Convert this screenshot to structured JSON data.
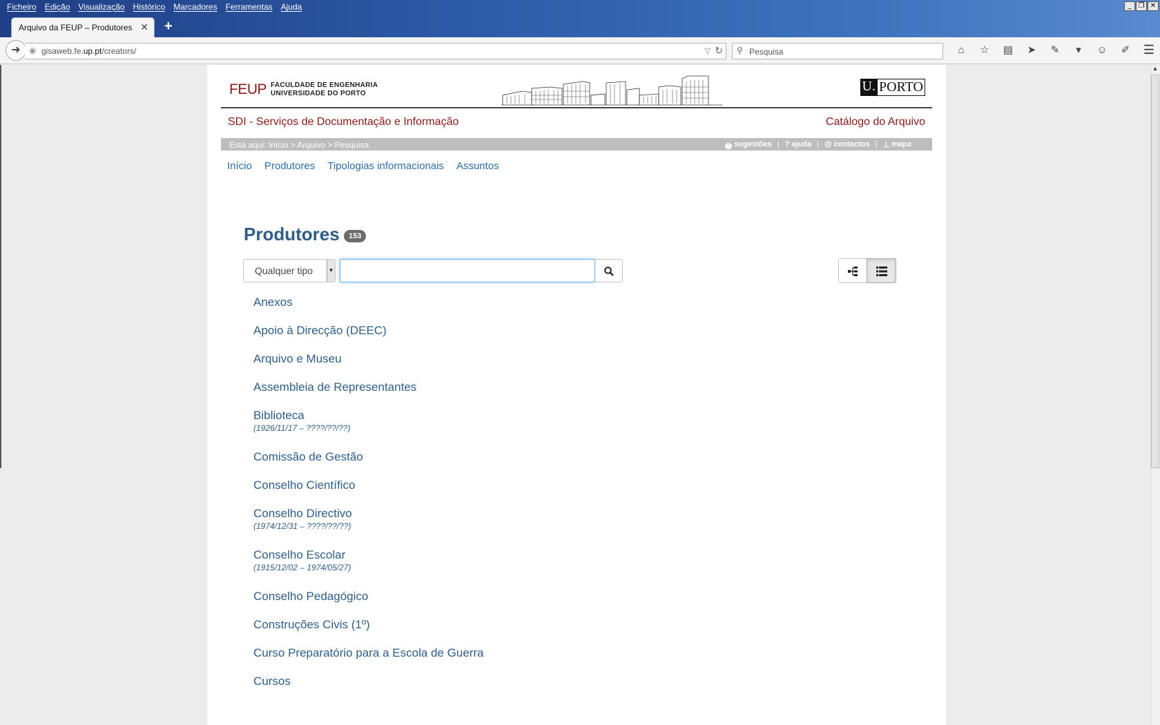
{
  "browser": {
    "menu": [
      "Ficheiro",
      "Edição",
      "Visualização",
      "Histórico",
      "Marcadores",
      "Ferramentas",
      "Ajuda"
    ],
    "tab_title": "Arquivo da FEUP – Produtores",
    "url_prefix": "gisaweb.fe.",
    "url_domain": "up.pt",
    "url_path": "/creators/",
    "search_placeholder": "Pesquisa"
  },
  "header": {
    "feup_mark": "FEUP",
    "feup_line1": "FACULDADE DE ENGENHARIA",
    "feup_line2": "UNIVERSIDADE DO PORTO",
    "uporto_u": "U.",
    "uporto_rest": "PORTO",
    "sdi": "SDI - Serviços de Documentação e Informação",
    "catalogo": "Catálogo do Arquivo"
  },
  "breadcrumb": {
    "text": "Está aqui: Início > Arquivo > Pesquisa",
    "links": [
      "sugestões",
      "ajuda",
      "contactos",
      "mapa"
    ]
  },
  "nav": [
    "Início",
    "Produtores",
    "Tipologias informacionais",
    "Assuntos"
  ],
  "main": {
    "title": "Produtores",
    "count": "153",
    "type_select": "Qualquer tipo",
    "query": ""
  },
  "producers": [
    {
      "name": "Anexos",
      "dates": ""
    },
    {
      "name": "Apoio à Direcção (DEEC)",
      "dates": ""
    },
    {
      "name": "Arquivo e Museu",
      "dates": ""
    },
    {
      "name": "Assembleia de Representantes",
      "dates": ""
    },
    {
      "name": "Biblioteca",
      "dates": "(1926/11/17 – ????/??/??)"
    },
    {
      "name": "Comissão de Gestão",
      "dates": ""
    },
    {
      "name": "Conselho Científico",
      "dates": ""
    },
    {
      "name": "Conselho Directivo",
      "dates": "(1974/12/31 – ????/??/??)"
    },
    {
      "name": "Conselho Escolar",
      "dates": "(1915/12/02 – 1974/05/27)"
    },
    {
      "name": "Conselho Pedagógico",
      "dates": ""
    },
    {
      "name": "Construções Civis (1º)",
      "dates": ""
    },
    {
      "name": "Curso Preparatório para a Escola de Guerra",
      "dates": ""
    },
    {
      "name": "Cursos",
      "dates": ""
    }
  ],
  "colors": {
    "feup_red": "#8a1a16",
    "link_blue": "#2f5d88",
    "nav_blue": "#2e6da4",
    "breadcrumb_gray": "#bdbdbd"
  }
}
